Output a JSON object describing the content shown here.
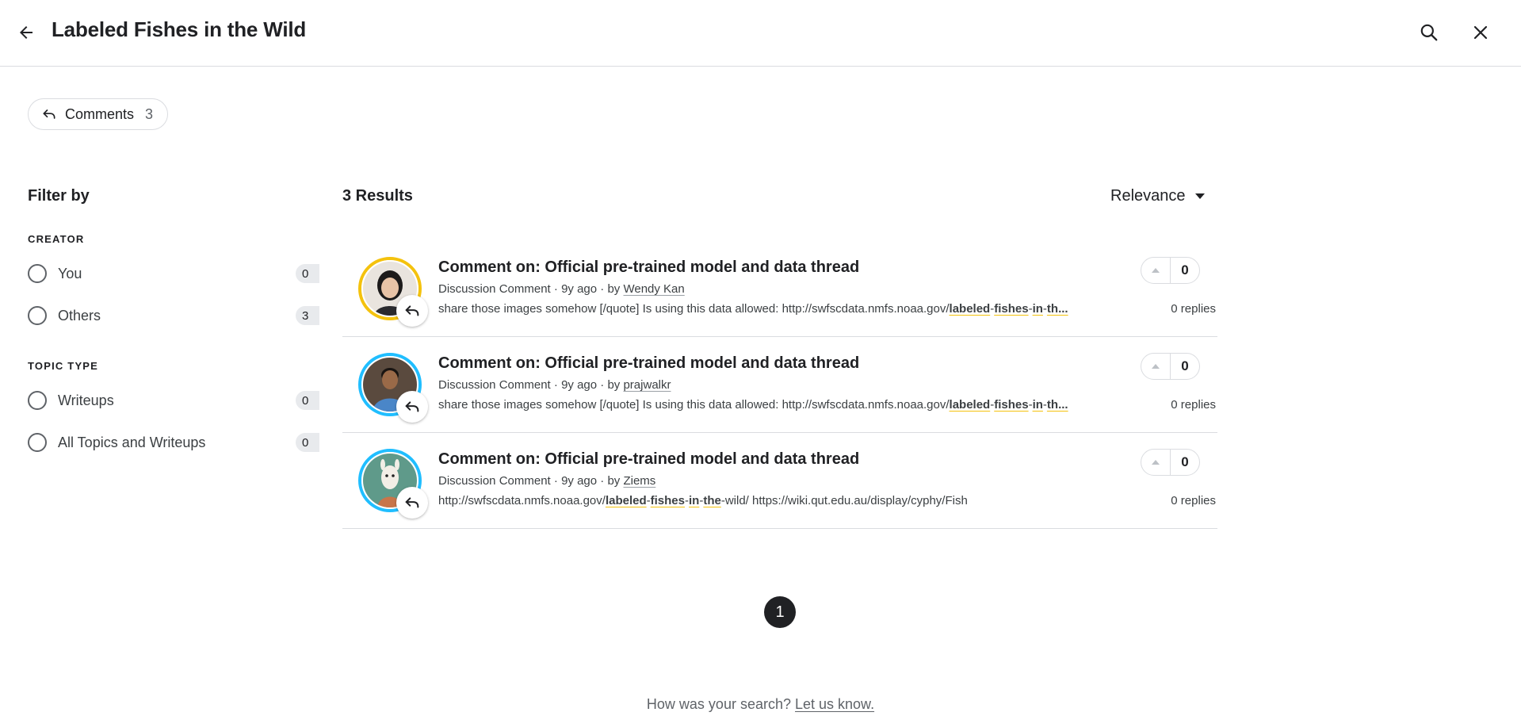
{
  "header": {
    "title": "Labeled Fishes in the Wild",
    "back_icon": "arrow-left-icon",
    "search_icon": "search-icon",
    "close_icon": "close-icon"
  },
  "chip": {
    "label": "Comments",
    "count": "3",
    "icon": "reply-icon"
  },
  "sidebar": {
    "title": "Filter by",
    "groups": [
      {
        "label": "CREATOR",
        "options": [
          {
            "label": "You",
            "count": "0"
          },
          {
            "label": "Others",
            "count": "3"
          }
        ]
      },
      {
        "label": "TOPIC TYPE",
        "options": [
          {
            "label": "Writeups",
            "count": "0"
          },
          {
            "label": "All Topics and Writeups",
            "count": "0"
          }
        ]
      }
    ]
  },
  "results": {
    "count_label": "3 Results",
    "sort_label": "Relevance",
    "items": [
      {
        "title": "Comment on: Official pre-trained model and data thread",
        "type": "Discussion Comment",
        "age": "9y ago",
        "by": "by",
        "author": "Wendy Kan",
        "snippet_pre": "share those images somehow [/quote] Is using this data allowed: http://swfscdata.nmfs.noaa.gov/",
        "snippet_hl1": "labeled",
        "snippet_sep1": "-",
        "snippet_hl2": "fishes",
        "snippet_sep2": "-",
        "snippet_hl3": "in",
        "snippet_sep3": "-",
        "snippet_hl4": "th...",
        "snippet_post": "",
        "replies": "0 replies",
        "votes": "0",
        "avatar_color": "#f4c20d"
      },
      {
        "title": "Comment on: Official pre-trained model and data thread",
        "type": "Discussion Comment",
        "age": "9y ago",
        "by": "by",
        "author": "prajwalkr",
        "snippet_pre": "share those images somehow [/quote] Is using this data allowed: http://swfscdata.nmfs.noaa.gov/",
        "snippet_hl1": "labeled",
        "snippet_sep1": "-",
        "snippet_hl2": "fishes",
        "snippet_sep2": "-",
        "snippet_hl3": "in",
        "snippet_sep3": "-",
        "snippet_hl4": "th...",
        "snippet_post": "",
        "replies": "0 replies",
        "votes": "0",
        "avatar_color": "#20beff"
      },
      {
        "title": "Comment on: Official pre-trained model and data thread",
        "type": "Discussion Comment",
        "age": "9y ago",
        "by": "by",
        "author": "Ziems",
        "snippet_pre": "http://swfscdata.nmfs.noaa.gov/",
        "snippet_hl1": "labeled",
        "snippet_sep1": "-",
        "snippet_hl2": "fishes",
        "snippet_sep2": "-",
        "snippet_hl3": "in",
        "snippet_sep3": "-",
        "snippet_hl4": "the",
        "snippet_post": "-wild/ https://wiki.qut.edu.au/display/cyphy/Fish",
        "replies": "0 replies",
        "votes": "0",
        "avatar_color": "#20beff"
      }
    ]
  },
  "pagination": {
    "current": "1"
  },
  "feedback": {
    "question": "How was your search?",
    "link": "Let us know."
  }
}
